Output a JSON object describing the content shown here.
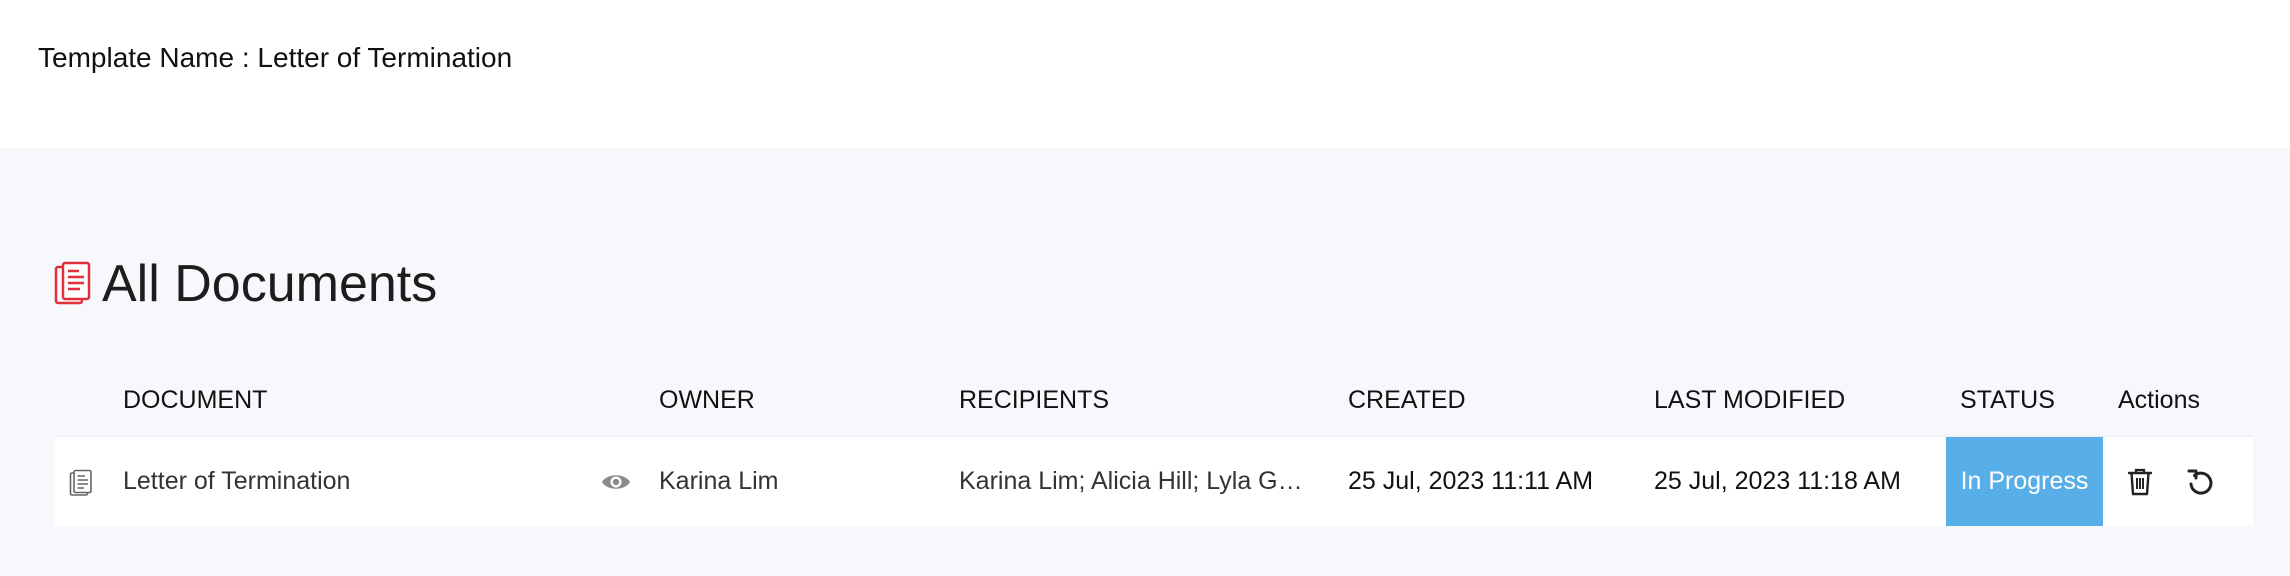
{
  "template": {
    "label": "Template Name : Letter of Termination"
  },
  "section": {
    "title": "All Documents",
    "icon": "documents-icon",
    "icon_color": "#e0303c"
  },
  "table": {
    "headers": {
      "document": "DOCUMENT",
      "owner": "OWNER",
      "recipients": "RECIPIENTS",
      "created": "CREATED",
      "last_modified": "LAST MODIFIED",
      "status": "STATUS",
      "actions": "Actions"
    },
    "rows": [
      {
        "document": "Letter of Termination",
        "owner": "Karina Lim",
        "recipients": "Karina Lim; Alicia Hill; Lyla G…",
        "created": "25 Jul, 2023 11:11 AM",
        "last_modified": "25 Jul, 2023 11:18 AM",
        "status": "In Progress",
        "status_color": "#58aee6",
        "icons": [
          "document-icon",
          "eye-icon",
          "trash-icon",
          "undo-icon"
        ]
      }
    ]
  }
}
